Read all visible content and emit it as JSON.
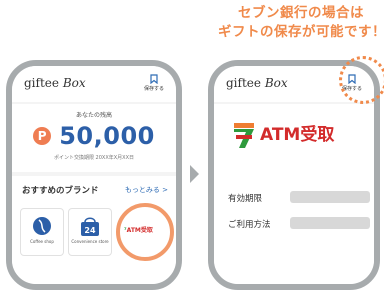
{
  "headline": {
    "line1": "セブン銀行の場合は",
    "line2": "ギフトの保存が可能です！"
  },
  "left_screen": {
    "logo_giftee": "giftee",
    "logo_box": "Box",
    "save_label": "保存する",
    "balance_label": "あなたの残高",
    "points_symbol": "P",
    "points_value": "50,000",
    "expiry_text": "ポイント交換期限 20XX年X月XX日",
    "brands_title": "おすすめのブランド",
    "brands_more": "もっとみる >",
    "brands": [
      {
        "caption": "Coffee shop"
      },
      {
        "caption": "Convenience store"
      },
      {
        "caption": "ATM受取"
      }
    ]
  },
  "right_screen": {
    "logo_giftee": "giftee",
    "logo_box": "Box",
    "save_label": "保存する",
    "atm_label": "ATM受取",
    "fields": [
      {
        "label": "有効期限"
      },
      {
        "label": "ご利用方法"
      }
    ]
  },
  "colors": {
    "accent_orange": "#f08a4b",
    "brand_blue": "#2c5fa8",
    "atm_red": "#d32b2b",
    "frame_gray": "#a7abad"
  }
}
